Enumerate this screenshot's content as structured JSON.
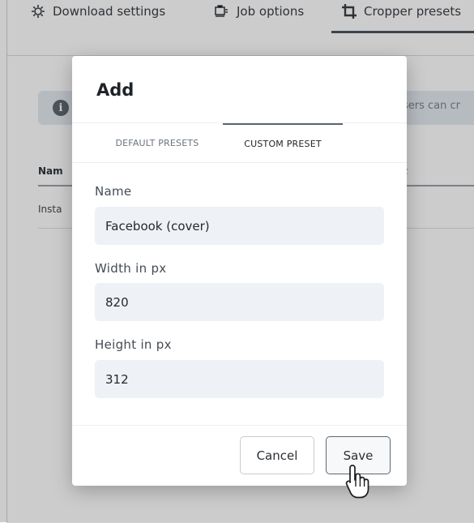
{
  "background_app": {
    "tabs": [
      {
        "label": "Download settings",
        "icon": "settings-cog-icon"
      },
      {
        "label": "Job options",
        "icon": "job-options-icon"
      },
      {
        "label": "Cropper presets",
        "icon": "crop-icon"
      }
    ],
    "info_icon": "info-icon",
    "info_text": "sers can cr",
    "table": {
      "headers": [
        "Nam",
        "t"
      ],
      "rows": [
        [
          "Insta",
          "t"
        ]
      ]
    }
  },
  "modal": {
    "title": "Add",
    "tabs": [
      {
        "label": "DEFAULT PRESETS",
        "active": false
      },
      {
        "label": "CUSTOM PRESET",
        "active": true
      }
    ],
    "fields": [
      {
        "label": "Name",
        "value": "Facebook (cover)"
      },
      {
        "label": "Width in px",
        "value": "820"
      },
      {
        "label": "Height in px",
        "value": "312"
      }
    ],
    "buttons": {
      "cancel": "Cancel",
      "save": "Save"
    }
  },
  "colors": {
    "overlay": "#00000033",
    "input_bg": "#eef1f5",
    "active_tab_line": "#5a6470"
  }
}
